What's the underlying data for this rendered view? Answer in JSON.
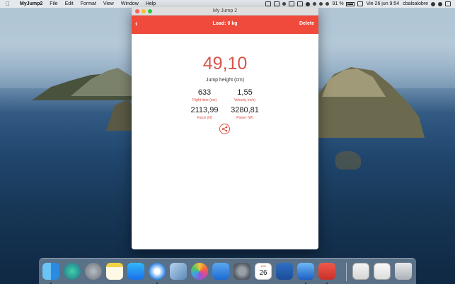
{
  "menubar": {
    "app_name": "MyJump2",
    "menus": [
      "File",
      "Edit",
      "Format",
      "View",
      "Window",
      "Help"
    ],
    "battery": "91 %",
    "datetime": "Vie 26 jun  9:54",
    "user": "cbalsalobre"
  },
  "window": {
    "title": "My Jump 2",
    "load": "Load: 0 kg",
    "delete_label": "Delete",
    "jump_height_value": "49,10",
    "jump_height_label": "Jump height (cm)",
    "metrics": [
      {
        "value": "633",
        "label": "Flight time (ms)"
      },
      {
        "value": "1,55",
        "label": "Velocity (m/s)"
      },
      {
        "value": "2113,99",
        "label": "Force (N)"
      },
      {
        "value": "3280,81",
        "label": "Power (W)"
      }
    ]
  },
  "dock": {
    "calendar_month": "JUN",
    "calendar_day": "26",
    "icons": [
      "finder-icon",
      "siri-icon",
      "launchpad-icon",
      "notes-icon",
      "app-store-icon",
      "safari-icon",
      "preview-icon",
      "photos-icon",
      "keynote-icon",
      "system-preferences-icon",
      "calendar-icon",
      "word-icon",
      "xcode-icon",
      "myjump-icon",
      "mail-icon",
      "preview-doc-icon",
      "trash-icon"
    ]
  },
  "colors": {
    "accent": "#ef4a3b",
    "value_text": "#d9534a"
  }
}
